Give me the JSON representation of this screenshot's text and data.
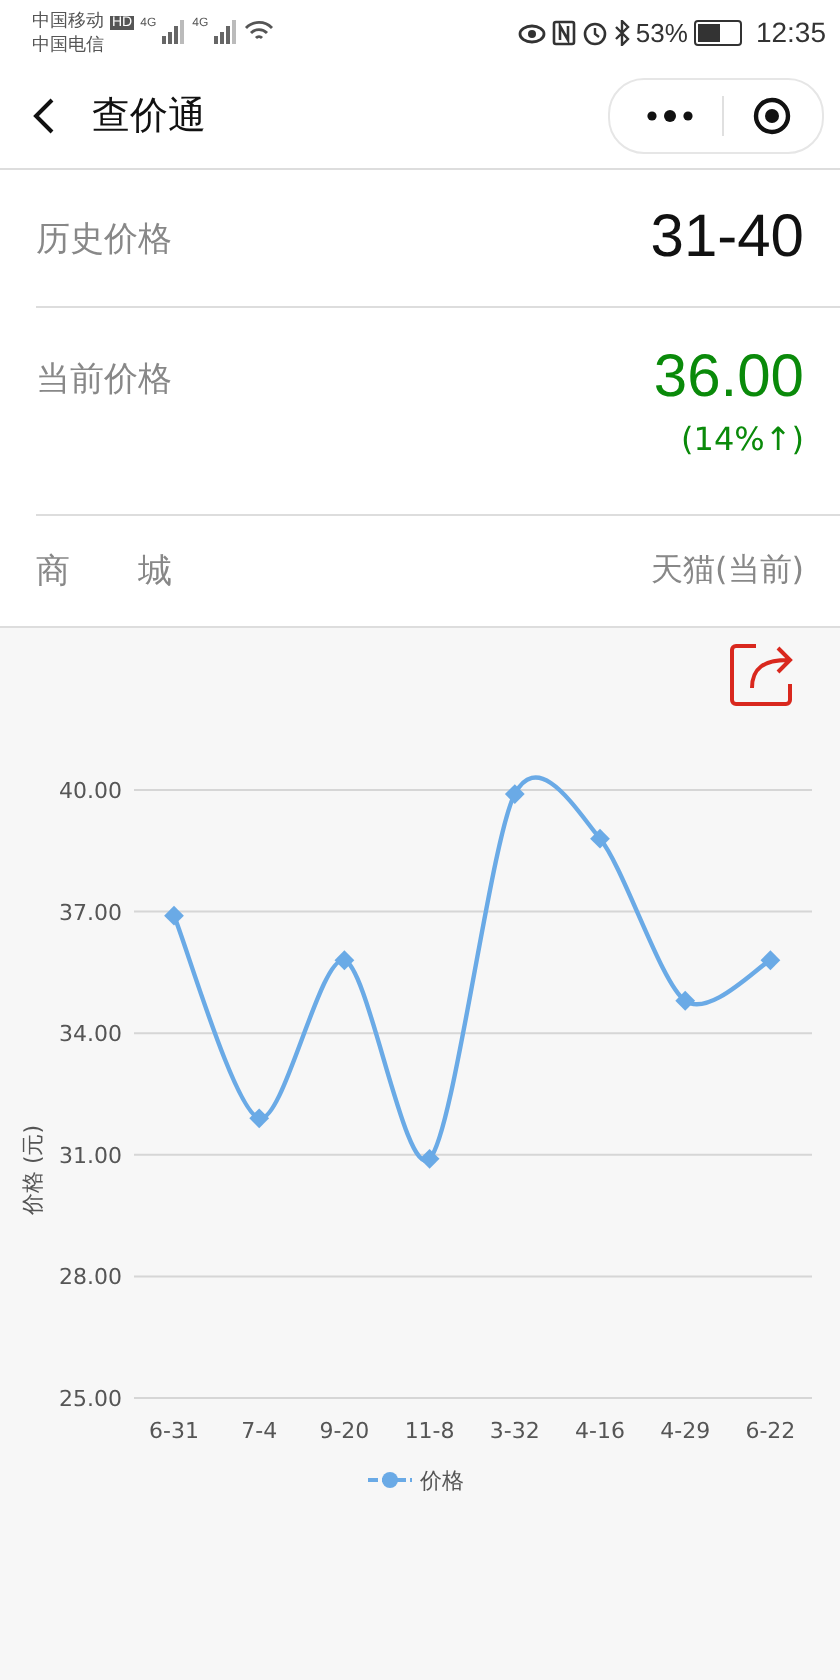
{
  "status_bar": {
    "carriers": [
      "中国移动",
      "中国电信"
    ],
    "hd": "HD",
    "networks": [
      "4G",
      "4G"
    ],
    "battery_percent": "53%",
    "time": "12:35"
  },
  "nav": {
    "title": "查价通"
  },
  "rows": [
    {
      "kind": "range",
      "label": "历史价格",
      "value": "31-40"
    },
    {
      "kind": "current",
      "label": "当前价格",
      "value": "36.00",
      "change": "(14%↑)",
      "color": "#0a8a0a"
    },
    {
      "kind": "store",
      "label": "商　　城",
      "value": "天猫(当前)"
    }
  ],
  "chart_data": {
    "type": "line",
    "ylabel": "价格 (元)",
    "categories": [
      "6-31",
      "7-4",
      "9-20",
      "11-8",
      "3-32",
      "4-16",
      "4-29",
      "6-22"
    ],
    "grid": true,
    "series": [
      {
        "name": "价格",
        "color": "#6aaae6",
        "marker": "diamond",
        "values": [
          36.9,
          31.9,
          35.8,
          30.9,
          39.9,
          38.8,
          34.8,
          35.8
        ]
      }
    ],
    "ylim": [
      25,
      40
    ],
    "yticks": [
      {
        "value": 25,
        "label": "25.00"
      },
      {
        "value": 28,
        "label": "28.00"
      },
      {
        "value": 31,
        "label": "31.00"
      },
      {
        "value": 34,
        "label": "34.00"
      },
      {
        "value": 37,
        "label": "37.00"
      },
      {
        "value": 40,
        "label": "40.00"
      }
    ]
  }
}
